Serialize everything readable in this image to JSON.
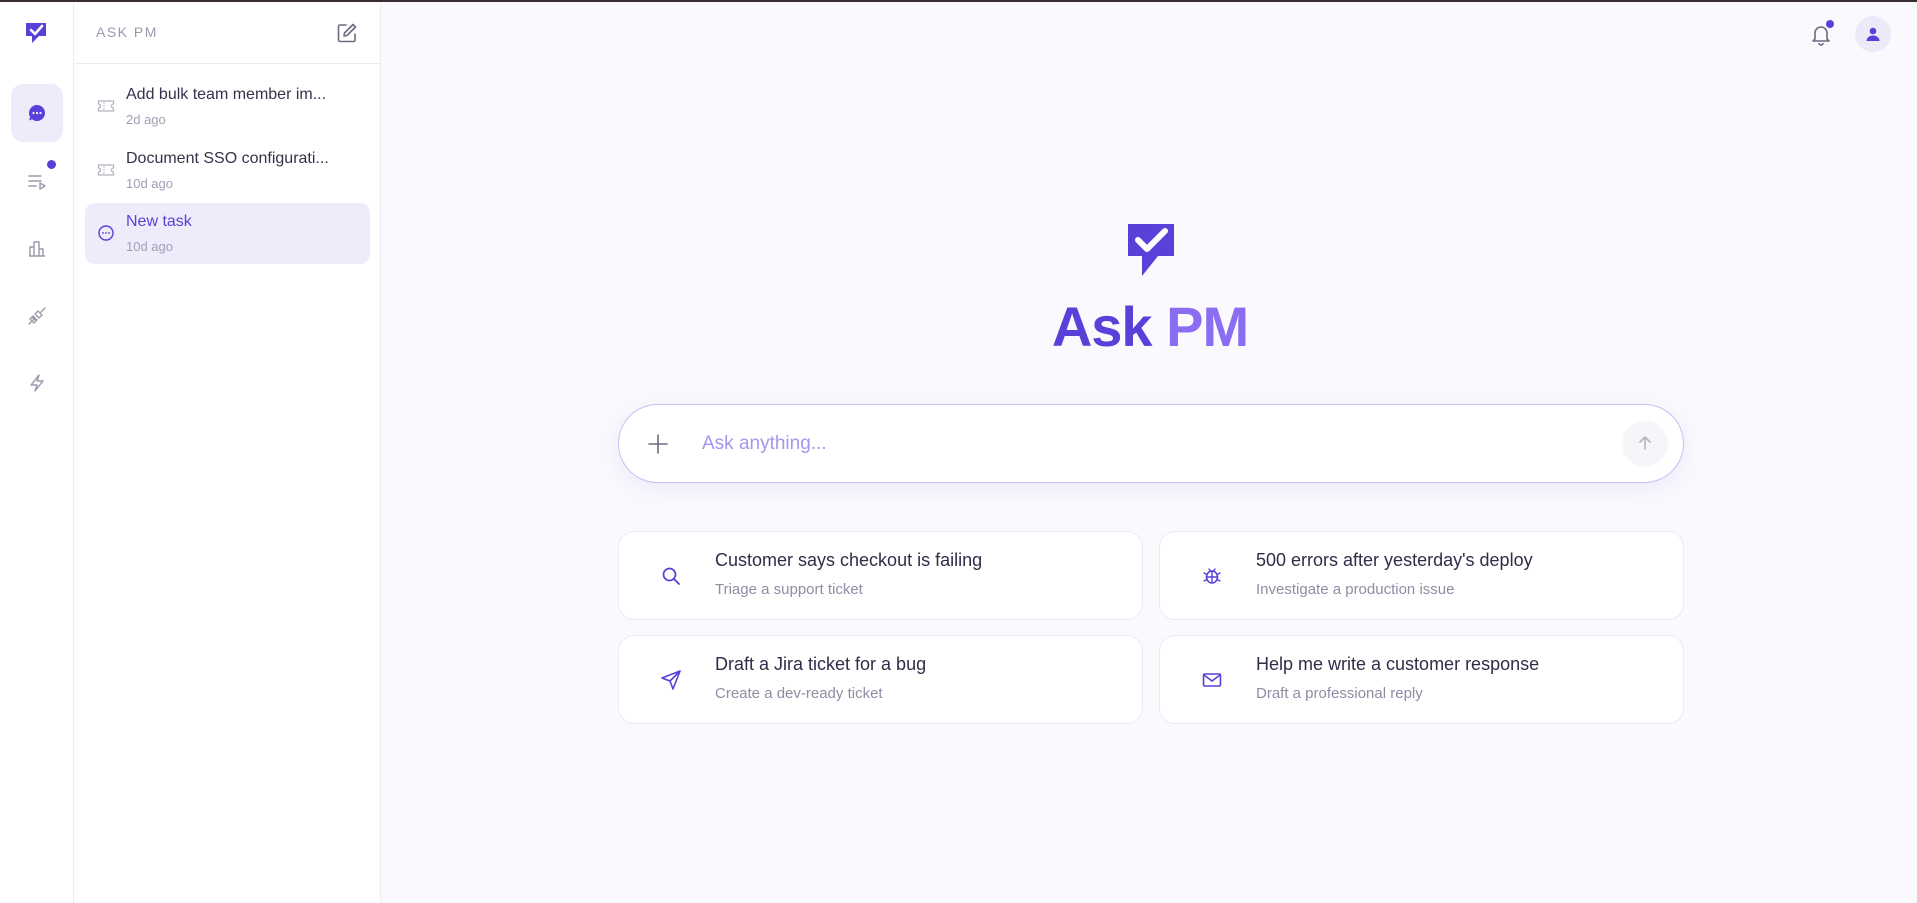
{
  "app": {
    "name": "ASK PM",
    "hero_title_part1": "Ask",
    "hero_title_part2": "PM"
  },
  "rail": {
    "items": [
      {
        "icon": "chat-icon",
        "active": true
      },
      {
        "icon": "task-queue-icon",
        "has_notification": true
      },
      {
        "icon": "bar-chart-icon"
      },
      {
        "icon": "plug-icon"
      },
      {
        "icon": "lightning-icon"
      }
    ]
  },
  "sidebar": {
    "title": "ASK PM",
    "items": [
      {
        "title": "Add bulk team member im...",
        "date": "2d ago",
        "icon": "ticket-icon"
      },
      {
        "title": "Document SSO configurati...",
        "date": "10d ago",
        "icon": "ticket-icon"
      },
      {
        "title": "New task",
        "date": "10d ago",
        "icon": "chat-icon",
        "active": true
      }
    ]
  },
  "search": {
    "placeholder": "Ask anything..."
  },
  "suggestions": [
    {
      "title": "Customer says checkout is failing",
      "subtitle": "Triage a support ticket",
      "icon": "search-icon"
    },
    {
      "title": "500 errors after yesterday's deploy",
      "subtitle": "Investigate a production issue",
      "icon": "bug-icon"
    },
    {
      "title": "Draft a Jira ticket for a bug",
      "subtitle": "Create a dev-ready ticket",
      "icon": "send-icon"
    },
    {
      "title": "Help me write a customer response",
      "subtitle": "Draft a professional reply",
      "icon": "mail-icon"
    }
  ],
  "colors": {
    "accent": "#5b3fd9",
    "accent_light": "#8b6df2",
    "active_bg": "#eeebfb"
  }
}
